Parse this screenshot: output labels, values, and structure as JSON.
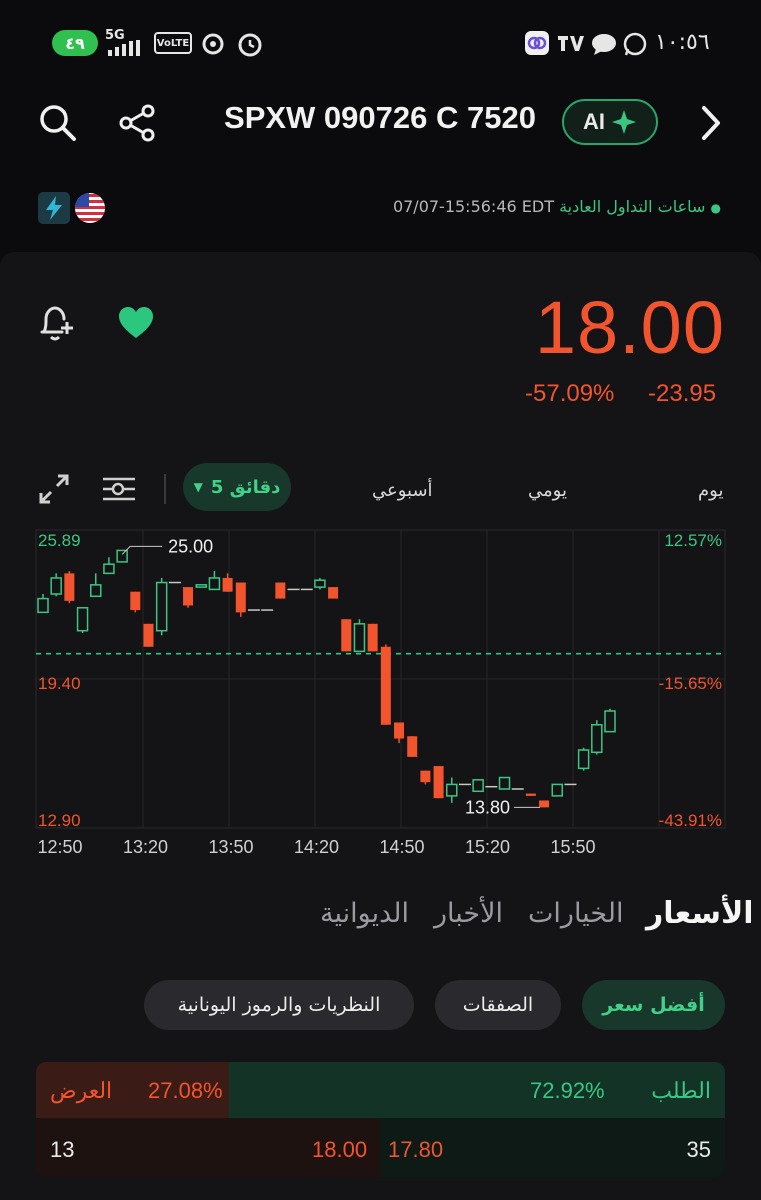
{
  "status_bar": {
    "battery": "٤٩",
    "network": "5G",
    "volte": "VoLTE",
    "time": "١٠:٥٦"
  },
  "header": {
    "title": "SPXW 090726 C 7520",
    "ai_label": "AI"
  },
  "session": {
    "status": "ساعات التداول العادية",
    "timestamp": "07/07-15:56:46 EDT"
  },
  "quote": {
    "price": "18.00",
    "change_pct": "-57.09%",
    "change_abs": "-23.95",
    "color_down": "#f2542d",
    "color_up": "#3cc683"
  },
  "period_tabs": {
    "day": "يوم",
    "daily": "يومي",
    "weekly": "أسبوعي",
    "interval": "5 دقائق"
  },
  "chart_data": {
    "type": "candlestick",
    "y_left_labels": [
      "25.89",
      "19.40",
      "12.90"
    ],
    "y_right_labels": [
      "12.57%",
      "-15.65%",
      "-43.91%"
    ],
    "x_labels": [
      "12:50",
      "13:20",
      "13:50",
      "14:20",
      "14:50",
      "15:20",
      "15:50"
    ],
    "ylim": [
      12.9,
      25.89
    ],
    "reference_line": 20.5,
    "annotations": [
      {
        "label": "25.00",
        "value": 25.0
      },
      {
        "label": "13.80",
        "value": 13.8
      }
    ],
    "candles": [
      {
        "open": 22.3,
        "close": 22.9,
        "high": 23.1,
        "low": 22.3
      },
      {
        "open": 23.1,
        "close": 23.8,
        "high": 24.0,
        "low": 23.0
      },
      {
        "open": 24.0,
        "close": 22.8,
        "high": 24.1,
        "low": 22.7
      },
      {
        "open": 21.5,
        "close": 22.5,
        "high": 22.5,
        "low": 21.4
      },
      {
        "open": 23.0,
        "close": 23.5,
        "high": 24.0,
        "low": 23.0
      },
      {
        "open": 24.0,
        "close": 24.4,
        "high": 24.7,
        "low": 24.0
      },
      {
        "open": 24.5,
        "close": 25.0,
        "high": 25.0,
        "low": 24.5
      },
      {
        "open": 23.2,
        "close": 22.4,
        "high": 23.2,
        "low": 22.3
      },
      {
        "open": 21.8,
        "close": 20.8,
        "high": 21.8,
        "low": 20.8
      },
      {
        "open": 21.5,
        "close": 23.6,
        "high": 23.8,
        "low": 21.3
      },
      {
        "open": 23.6,
        "close": 23.6,
        "high": 23.6,
        "low": 23.6
      },
      {
        "open": 23.4,
        "close": 22.6,
        "high": 23.4,
        "low": 22.5
      },
      {
        "open": 23.4,
        "close": 23.5,
        "high": 23.5,
        "low": 23.4
      },
      {
        "open": 23.3,
        "close": 23.8,
        "high": 24.1,
        "low": 23.3
      },
      {
        "open": 23.8,
        "close": 23.2,
        "high": 24.0,
        "low": 23.2
      },
      {
        "open": 23.6,
        "close": 22.3,
        "high": 23.6,
        "low": 22.1
      },
      {
        "open": 22.4,
        "close": 22.4,
        "high": 22.4,
        "low": 22.4
      },
      {
        "open": 22.4,
        "close": 22.4,
        "high": 22.4,
        "low": 22.4
      },
      {
        "open": 23.6,
        "close": 22.9,
        "high": 23.6,
        "low": 22.9
      },
      {
        "open": 23.3,
        "close": 23.3,
        "high": 23.3,
        "low": 23.3
      },
      {
        "open": 23.3,
        "close": 23.3,
        "high": 23.3,
        "low": 23.3
      },
      {
        "open": 23.4,
        "close": 23.7,
        "high": 23.8,
        "low": 23.3
      },
      {
        "open": 23.4,
        "close": 22.9,
        "high": 23.4,
        "low": 22.9
      },
      {
        "open": 22.0,
        "close": 20.6,
        "high": 22.0,
        "low": 20.6
      },
      {
        "open": 20.6,
        "close": 21.8,
        "high": 22.0,
        "low": 20.6
      },
      {
        "open": 21.8,
        "close": 20.6,
        "high": 21.8,
        "low": 20.6
      },
      {
        "open": 20.8,
        "close": 17.4,
        "high": 20.9,
        "low": 17.4
      },
      {
        "open": 17.5,
        "close": 16.8,
        "high": 17.5,
        "low": 16.6
      },
      {
        "open": 16.9,
        "close": 16.0,
        "high": 16.9,
        "low": 16.0
      },
      {
        "open": 15.4,
        "close": 14.9,
        "high": 15.4,
        "low": 14.8
      },
      {
        "open": 15.6,
        "close": 14.2,
        "high": 15.6,
        "low": 14.2
      },
      {
        "open": 14.3,
        "close": 14.8,
        "high": 15.1,
        "low": 14.0
      },
      {
        "open": 14.8,
        "close": 14.8,
        "high": 14.8,
        "low": 14.8
      },
      {
        "open": 14.5,
        "close": 15.0,
        "high": 15.0,
        "low": 14.5
      },
      {
        "open": 14.7,
        "close": 14.7,
        "high": 14.7,
        "low": 14.7
      },
      {
        "open": 14.6,
        "close": 15.1,
        "high": 15.1,
        "low": 14.6
      },
      {
        "open": 14.6,
        "close": 14.6,
        "high": 14.6,
        "low": 14.6
      },
      {
        "open": 14.4,
        "close": 14.3,
        "high": 14.4,
        "low": 14.3
      },
      {
        "open": 14.1,
        "close": 13.8,
        "high": 14.1,
        "low": 13.8
      },
      {
        "open": 14.3,
        "close": 14.8,
        "high": 14.8,
        "low": 14.3
      },
      {
        "open": 14.8,
        "close": 14.8,
        "high": 14.8,
        "low": 14.8
      },
      {
        "open": 15.5,
        "close": 16.3,
        "high": 16.4,
        "low": 15.4
      },
      {
        "open": 16.2,
        "close": 17.4,
        "high": 17.6,
        "low": 16.1
      },
      {
        "open": 17.1,
        "close": 18.0,
        "high": 18.1,
        "low": 17.1
      }
    ]
  },
  "section_tabs": {
    "prices": "الأسعار",
    "options": "الخيارات",
    "news": "الأخبار",
    "community": "الديوانية"
  },
  "sub_tabs": {
    "best_price": "أفضل سعر",
    "trades": "الصفقات",
    "greeks": "النظريات والرموز اليونانية"
  },
  "order_book": {
    "bid_label": "الطلب",
    "bid_pct": "72.92%",
    "ask_label": "العرض",
    "ask_pct": "27.08%",
    "bid_size": "35",
    "bid_price": "17.80",
    "ask_price": "18.00",
    "ask_size": "13"
  }
}
